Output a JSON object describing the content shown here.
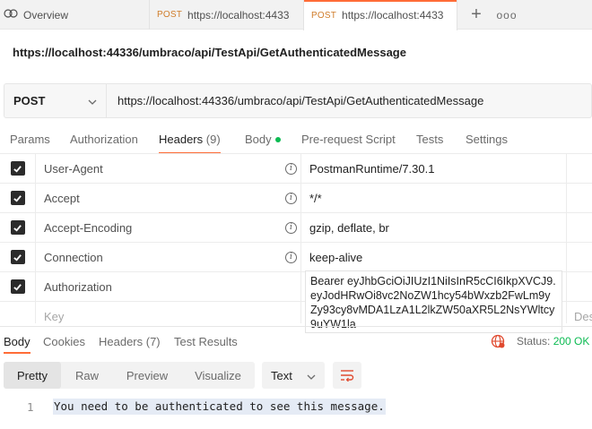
{
  "tabs": {
    "overview_label": "Overview",
    "items": [
      {
        "method": "POST",
        "url": "https://localhost:4433"
      },
      {
        "method": "POST",
        "url": "https://localhost:4433"
      }
    ],
    "plus": "+",
    "more": "ooo"
  },
  "request": {
    "title": "https://localhost:44336/umbraco/api/TestApi/GetAuthenticatedMessage",
    "method": "POST",
    "url": "https://localhost:44336/umbraco/api/TestApi/GetAuthenticatedMessage"
  },
  "request_tabs": {
    "params": "Params",
    "authorization": "Authorization",
    "headers": "Headers",
    "headers_count": "(9)",
    "body": "Body",
    "prerequest": "Pre-request Script",
    "tests": "Tests",
    "settings": "Settings"
  },
  "headers": [
    {
      "key": "User-Agent",
      "value": "PostmanRuntime/7.30.1",
      "checked": true
    },
    {
      "key": "Accept",
      "value": "*/*",
      "checked": true
    },
    {
      "key": "Accept-Encoding",
      "value": "gzip, deflate, br",
      "checked": true
    },
    {
      "key": "Connection",
      "value": "keep-alive",
      "checked": true
    },
    {
      "key": "Authorization",
      "value": "Bearer eyJhbGciOiJIUzI1NiIsInR5cCI6IkpXVCJ9.eyJodHRwOi8vc2NoZW1hcy54bWxzb2FwLm9yZy93cy8vMDA1LzA1L2lkZW50aXR5L2NsYWltcy9uYW1la",
      "checked": true
    }
  ],
  "new_header": {
    "key_placeholder": "Key",
    "desc_placeholder": "Des"
  },
  "response": {
    "tabs": {
      "body": "Body",
      "cookies": "Cookies",
      "headers": "Headers (7)",
      "test_results": "Test Results"
    },
    "status_label": "Status:",
    "status_value": "200 OK",
    "views": {
      "pretty": "Pretty",
      "raw": "Raw",
      "preview": "Preview",
      "visualize": "Visualize"
    },
    "format": "Text",
    "line_number": "1",
    "body_line": "You need to be authenticated to see this message."
  },
  "colors": {
    "accent": "#ff6c37",
    "status_ok": "#0cbb52",
    "method": "#d07d2c"
  }
}
